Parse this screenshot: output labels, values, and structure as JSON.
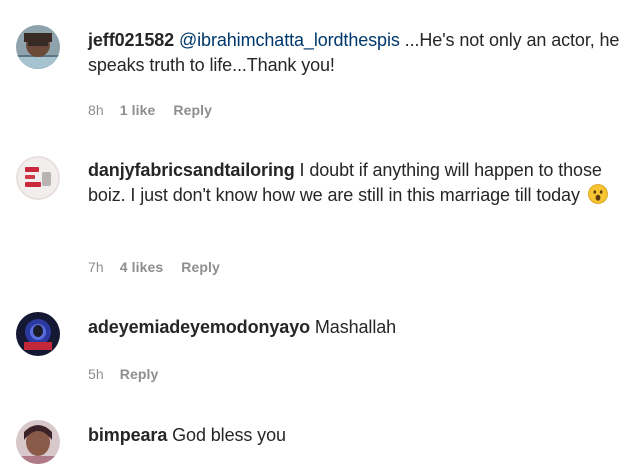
{
  "comments": [
    {
      "username": "jeff021582",
      "mention": "@ibrahimchatta_lordthespis",
      "text": " ...He's not only an actor, he speaks truth to life...Thank you!",
      "time": "8h",
      "likes": "1 like",
      "reply": "Reply",
      "avatar_icon": "user-avatar-icon"
    },
    {
      "username": "danjyfabricsandtailoring",
      "text": " I doubt if anything will happen to those boiz. I just don't know how we are still in this marriage till today",
      "emoji": "astonished-face-emoji",
      "time": "7h",
      "likes": "4 likes",
      "reply": "Reply",
      "avatar_icon": "brand-logo-avatar-icon"
    },
    {
      "username": "adeyemiadeyemodonyayo",
      "text": " Mashallah",
      "time": "5h",
      "reply": "Reply",
      "avatar_icon": "user-avatar-icon"
    },
    {
      "username": "bimpeara",
      "text": " God bless you",
      "avatar_icon": "user-avatar-icon"
    }
  ],
  "colors": {
    "text": "#262626",
    "meta": "#8e8e8e",
    "mention": "#00376b",
    "background": "#ffffff"
  }
}
